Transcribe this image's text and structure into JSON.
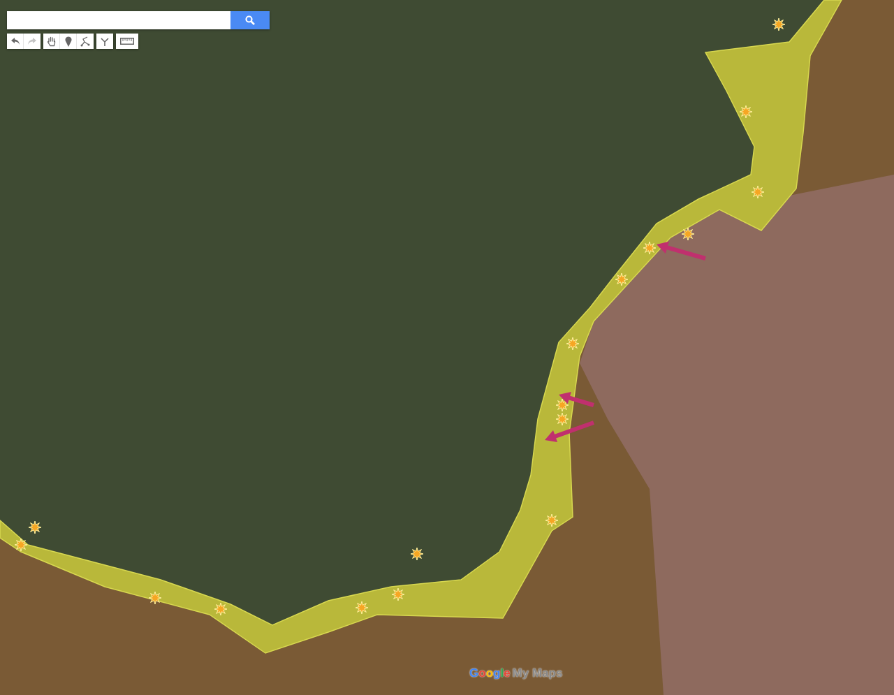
{
  "toolbar": [
    {
      "tools": [
        {
          "kind": "undo",
          "disabled": false
        },
        {
          "kind": "redo",
          "disabled": true
        }
      ]
    },
    {
      "tools": [
        {
          "kind": "hand",
          "disabled": false
        },
        {
          "kind": "marker",
          "disabled": false
        },
        {
          "kind": "line",
          "disabled": false
        }
      ]
    },
    {
      "tools": [
        {
          "kind": "route",
          "disabled": false
        }
      ]
    },
    {
      "tools": [
        {
          "kind": "ruler",
          "disabled": false
        }
      ]
    }
  ],
  "logo": {
    "brand": "Google",
    "product": "My Maps"
  }
}
